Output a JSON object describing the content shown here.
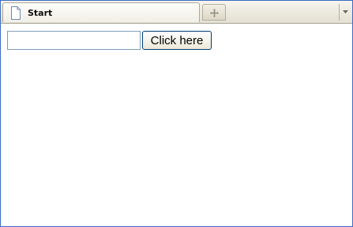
{
  "tabs": {
    "active_label": "Start",
    "active_icon": "document-icon",
    "new_tab_icon": "new-tab-icon",
    "list_icon": "chevron-down-icon"
  },
  "page": {
    "input": {
      "value": "",
      "placeholder": ""
    },
    "button_label": "Click here"
  },
  "colors": {
    "window_border": "#3d6bc4",
    "input_border": "#7f9db9",
    "button_border": "#003c74"
  }
}
